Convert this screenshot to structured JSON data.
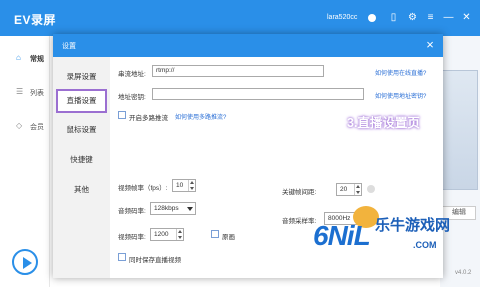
{
  "app": {
    "title": "EV录屏",
    "user": "lara520cc",
    "version": "v4.0.2",
    "sidebar": [
      {
        "label": "常规",
        "icon": "home-icon"
      },
      {
        "label": "列表",
        "icon": "list-icon"
      },
      {
        "label": "会员",
        "icon": "diamond-icon"
      }
    ],
    "edit_button": "编辑"
  },
  "dialog": {
    "title": "设置",
    "nav": [
      {
        "label": "录屏设置"
      },
      {
        "label": "直播设置"
      },
      {
        "label": "鼠标设置"
      },
      {
        "label": "快捷键"
      },
      {
        "label": "其他"
      }
    ],
    "active_nav": "直播设置",
    "form": {
      "stream_url_label": "串流地址:",
      "stream_url_value": "rtmp://",
      "stream_url_help": "如何使用在线直播?",
      "stream_key_label": "地址密钥:",
      "stream_key_value": "",
      "stream_key_help": "如何使用地址密钥?",
      "multi_stream_label": "开启多路推流",
      "multi_stream_help": "如何使用多路推流?",
      "fps_label": "视频帧率（fps）:",
      "fps_value": "10",
      "keyframe_label": "关键帧间距:",
      "keyframe_value": "20",
      "audio_bitrate_label": "音频码率:",
      "audio_bitrate_value": "128kbps",
      "sample_rate_label": "音频采样率:",
      "sample_rate_value": "8000Hz",
      "video_bitrate_label": "视频码率:",
      "video_bitrate_value": "1200",
      "original_label": "原画",
      "save_while_stream_label": "同时保存直播视频"
    }
  },
  "overlay_caption": "3.直播设置页",
  "watermark": {
    "logo": "6NiL",
    "site": "乐牛游戏网",
    "domain": ".COM"
  },
  "colors": {
    "accent": "#2a8fe8",
    "nav_highlight": "#9b6fd1",
    "link": "#2a6fd6"
  }
}
